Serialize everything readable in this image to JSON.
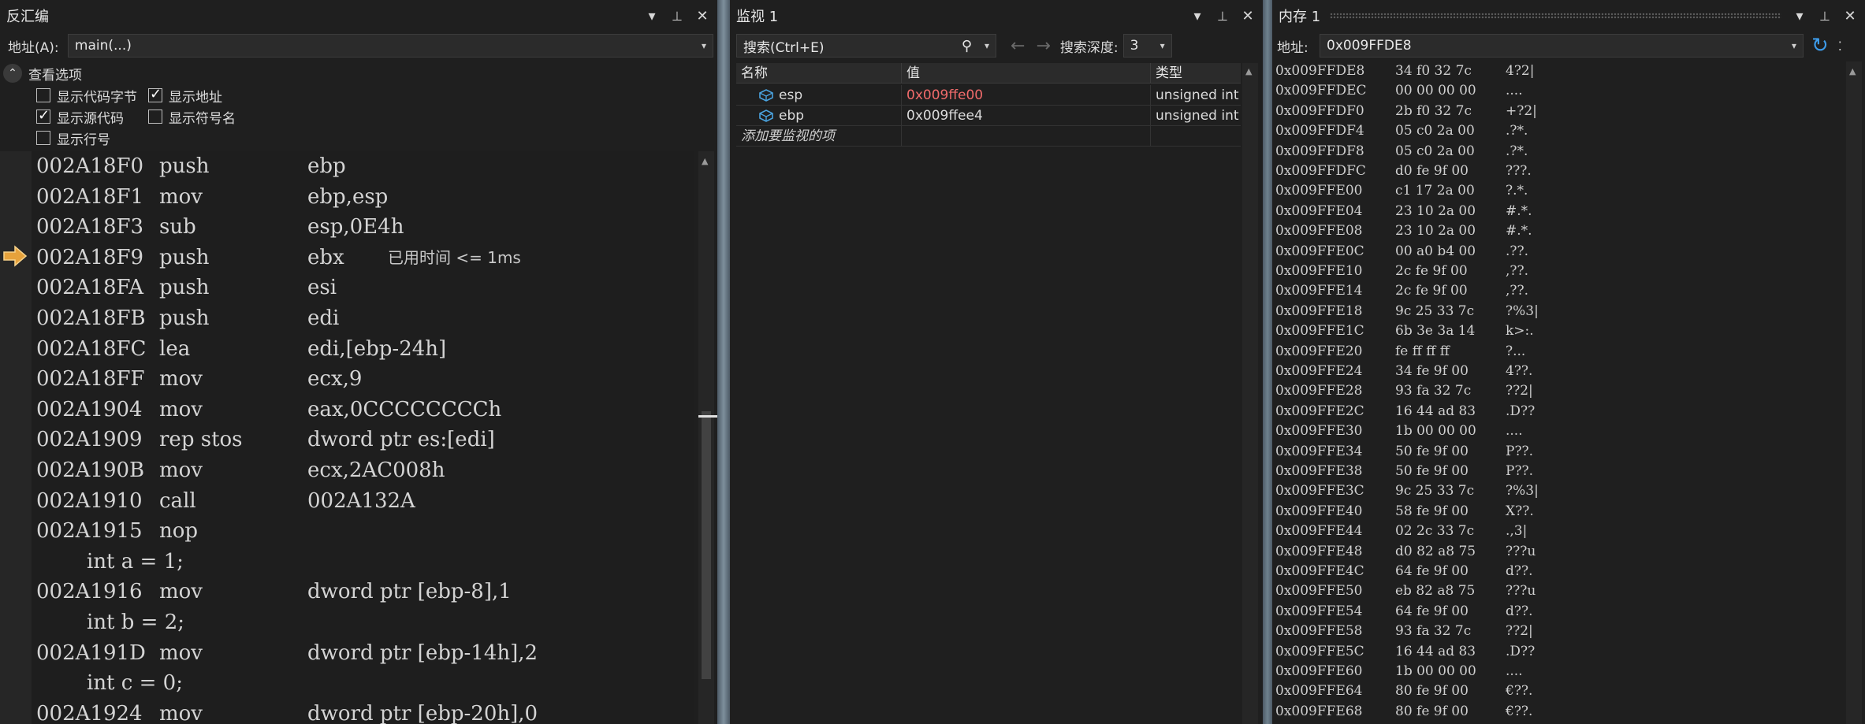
{
  "disasm": {
    "title": "反汇编",
    "address_label": "地址(A):",
    "address_value": "main(...)",
    "view_options_label": "查看选项",
    "options": [
      {
        "label": "显示代码字节",
        "checked": false
      },
      {
        "label": "显示地址",
        "checked": true
      },
      {
        "label": "显示源代码",
        "checked": true
      },
      {
        "label": "显示符号名",
        "checked": false
      },
      {
        "label": "显示行号",
        "checked": false
      }
    ],
    "lines": [
      {
        "addr": "002A18F0",
        "op": "push",
        "arg": "ebp"
      },
      {
        "addr": "002A18F1",
        "op": "mov",
        "arg": "ebp,esp"
      },
      {
        "addr": "002A18F3",
        "op": "sub",
        "arg": "esp,0E4h"
      },
      {
        "addr": "002A18F9",
        "op": "push",
        "arg": "ebx",
        "hint": "已用时间 <= 1ms",
        "current": true
      },
      {
        "addr": "002A18FA",
        "op": "push",
        "arg": "esi"
      },
      {
        "addr": "002A18FB",
        "op": "push",
        "arg": "edi"
      },
      {
        "addr": "002A18FC",
        "op": "lea",
        "arg": "edi,[ebp-24h]"
      },
      {
        "addr": "002A18FF",
        "op": "mov",
        "arg": "ecx,9"
      },
      {
        "addr": "002A1904",
        "op": "mov",
        "arg": "eax,0CCCCCCCCh"
      },
      {
        "addr": "002A1909",
        "op": "rep stos",
        "arg": "dword ptr es:[edi]"
      },
      {
        "addr": "002A190B",
        "op": "mov",
        "arg": "ecx,2AC008h"
      },
      {
        "addr": "002A1910",
        "op": "call",
        "arg": "002A132A"
      },
      {
        "addr": "002A1915",
        "op": "nop",
        "arg": ""
      },
      {
        "src": "int a = 1;"
      },
      {
        "addr": "002A1916",
        "op": "mov",
        "arg": "dword ptr [ebp-8],1"
      },
      {
        "src": "int b = 2;"
      },
      {
        "addr": "002A191D",
        "op": "mov",
        "arg": "dword ptr [ebp-14h],2"
      },
      {
        "src": "int c = 0;"
      },
      {
        "addr": "002A1924",
        "op": "mov",
        "arg": "dword ptr [ebp-20h],0"
      }
    ]
  },
  "watch": {
    "title": "监视 1",
    "search_placeholder": "搜索(Ctrl+E)",
    "depth_label": "搜索深度:",
    "depth_value": "3",
    "columns": [
      "名称",
      "值",
      "类型"
    ],
    "rows": [
      {
        "name": "esp",
        "value": "0x009ffe00",
        "type": "unsigned int",
        "changed": true
      },
      {
        "name": "ebp",
        "value": "0x009ffee4",
        "type": "unsigned int",
        "changed": false
      }
    ],
    "add_item_text": "添加要监视的项"
  },
  "memory": {
    "title": "内存 1",
    "address_label": "地址:",
    "address_value": "0x009FFDE8",
    "lines": [
      [
        "0x009FFDE8",
        "34 f0 32 7c",
        "4?2|"
      ],
      [
        "0x009FFDEC",
        "00 00 00 00",
        "...."
      ],
      [
        "0x009FFDF0",
        "2b f0 32 7c",
        "+?2|"
      ],
      [
        "0x009FFDF4",
        "05 c0 2a 00",
        ".?*."
      ],
      [
        "0x009FFDF8",
        "05 c0 2a 00",
        ".?*."
      ],
      [
        "0x009FFDFC",
        "d0 fe 9f 00",
        "???."
      ],
      [
        "0x009FFE00",
        "c1 17 2a 00",
        "?.*."
      ],
      [
        "0x009FFE04",
        "23 10 2a 00",
        "#.*."
      ],
      [
        "0x009FFE08",
        "23 10 2a 00",
        "#.*."
      ],
      [
        "0x009FFE0C",
        "00 a0 b4 00",
        ".??."
      ],
      [
        "0x009FFE10",
        "2c fe 9f 00",
        ",??."
      ],
      [
        "0x009FFE14",
        "2c fe 9f 00",
        ",??."
      ],
      [
        "0x009FFE18",
        "9c 25 33 7c",
        "?%3|"
      ],
      [
        "0x009FFE1C",
        "6b 3e 3a 14",
        "k>:."
      ],
      [
        "0x009FFE20",
        "fe ff ff ff",
        "?..."
      ],
      [
        "0x009FFE24",
        "34 fe 9f 00",
        "4??."
      ],
      [
        "0x009FFE28",
        "93 fa 32 7c",
        "??2|"
      ],
      [
        "0x009FFE2C",
        "16 44 ad 83",
        ".D??"
      ],
      [
        "0x009FFE30",
        "1b 00 00 00",
        "...."
      ],
      [
        "0x009FFE34",
        "50 fe 9f 00",
        "P??."
      ],
      [
        "0x009FFE38",
        "50 fe 9f 00",
        "P??."
      ],
      [
        "0x009FFE3C",
        "9c 25 33 7c",
        "?%3|"
      ],
      [
        "0x009FFE40",
        "58 fe 9f 00",
        "X??."
      ],
      [
        "0x009FFE44",
        "02 2c 33 7c",
        ".,3|"
      ],
      [
        "0x009FFE48",
        "d0 82 a8 75",
        "???u"
      ],
      [
        "0x009FFE4C",
        "64 fe 9f 00",
        "d??."
      ],
      [
        "0x009FFE50",
        "eb 82 a8 75",
        "???u"
      ],
      [
        "0x009FFE54",
        "64 fe 9f 00",
        "d??."
      ],
      [
        "0x009FFE58",
        "93 fa 32 7c",
        "??2|"
      ],
      [
        "0x009FFE5C",
        "16 44 ad 83",
        ".D??"
      ],
      [
        "0x009FFE60",
        "1b 00 00 00",
        "...."
      ],
      [
        "0x009FFE64",
        "80 fe 9f 00",
        "€??."
      ],
      [
        "0x009FFE68",
        "80 fe 9f 00",
        "€??."
      ]
    ]
  },
  "icons": {
    "dropdown": "▾",
    "pin": "📌",
    "close": "✕",
    "collapse": "⌃",
    "back": "←",
    "forward": "→",
    "search": "⚲",
    "refresh": "↻",
    "current_arrow": "⇨",
    "variable": "◈"
  },
  "colors": {
    "accent": "#007acc",
    "changed_value": "#f16b6b",
    "current_arrow": "#e6a23c",
    "memory_title_accent": "#8a70d6"
  }
}
